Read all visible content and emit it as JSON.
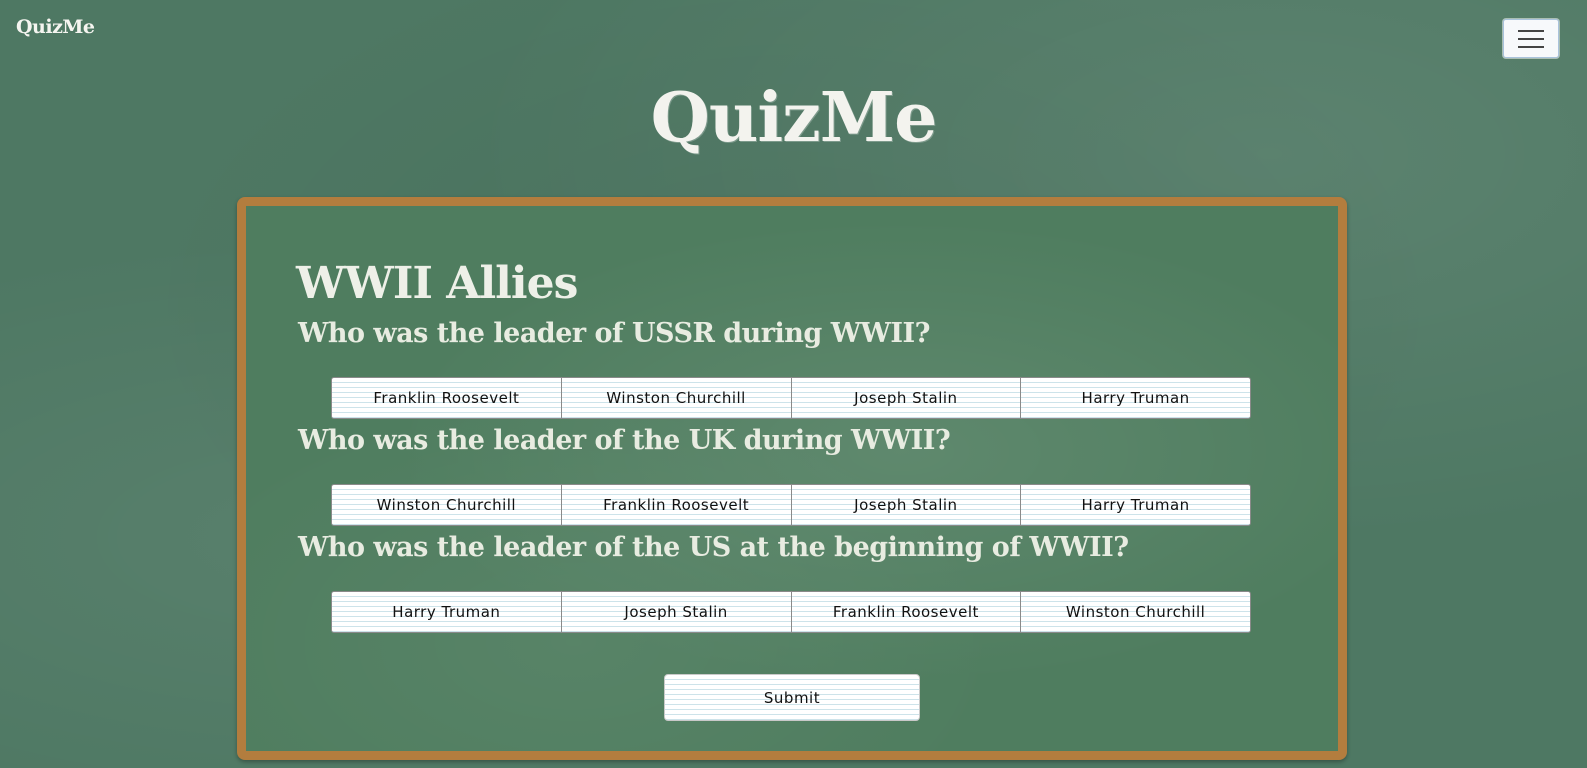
{
  "navbar": {
    "brand": "QuizMe",
    "menu_icon": "hamburger-menu-icon"
  },
  "header": {
    "title": "QuizMe"
  },
  "quiz": {
    "title": "WWII Allies",
    "questions": [
      {
        "text": "Who was the leader of USSR during WWII?",
        "answers": [
          "Franklin Roosevelt",
          "Winston Churchill",
          "Joseph Stalin",
          "Harry Truman"
        ]
      },
      {
        "text": "Who was the leader of the UK during WWII?",
        "answers": [
          "Winston Churchill",
          "Franklin Roosevelt",
          "Joseph Stalin",
          "Harry Truman"
        ]
      },
      {
        "text": "Who was the leader of the US at the beginning of WWII?",
        "answers": [
          "Harry Truman",
          "Joseph Stalin",
          "Franklin Roosevelt",
          "Winston Churchill"
        ]
      }
    ],
    "submit_label": "Submit"
  },
  "colors": {
    "background": "#4e7863",
    "board": "#4f7d5f",
    "board_frame": "#b37d3e"
  }
}
